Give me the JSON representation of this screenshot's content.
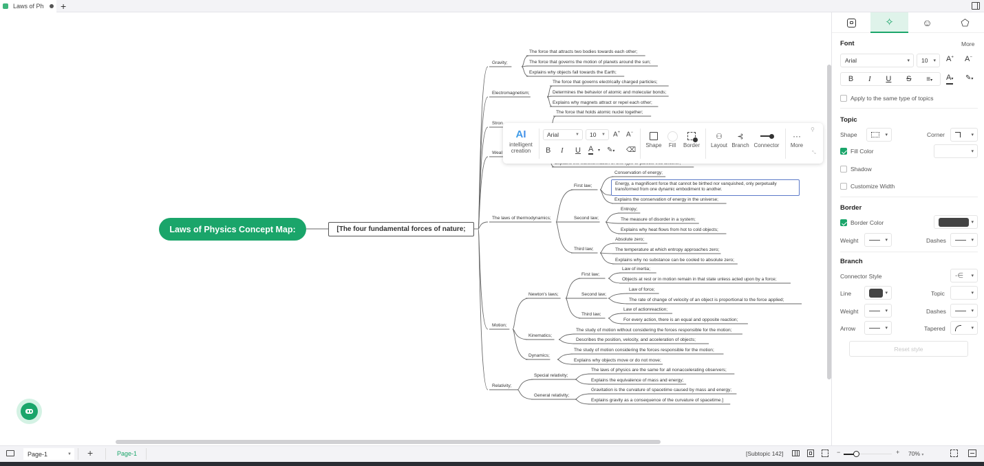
{
  "tabbar": {
    "doc_tab": "Laws of Ph",
    "new_tab": "+"
  },
  "mindmap": {
    "root": "Laws of Physics Concept Map:",
    "main": "[The four fundamental forces of nature;",
    "branches": [
      {
        "label": "Gravity;",
        "children": [
          "The force that attracts two bodies towards each other;",
          "The force that governs the motion of planets around the sun;",
          "Explains why objects fall towards the Earth;"
        ]
      },
      {
        "label": "Electromagnetism;",
        "children": [
          "The force that governs electrically charged particles;",
          "Determines the behavior of atomic and molecular bonds;",
          "Explains why magnets attract or repel each other;"
        ]
      },
      {
        "label": "Stron",
        "children": [
          "The force that holds atomic nuclei together;"
        ]
      },
      {
        "label": "Weal",
        "children": [
          "Explains the transformation of one type of particle into another;"
        ]
      },
      {
        "label": "The laws of thermodynamics;",
        "children": [
          {
            "label": "First law;",
            "children": [
              "Conservation of energy;",
              "Energy, a magnificent force that cannot be birthed nor vanquished, only perpetually transformed from one dynamic embodiment to another.",
              "Explains the conservation of energy in the universe;"
            ]
          },
          {
            "label": "Second law;",
            "children": [
              "Entropy;",
              "The measure of disorder in a system;",
              "Explains why heat flows from hot to cold objects;"
            ]
          },
          {
            "label": "Third law;",
            "children": [
              "Absolute zero;",
              "The temperature at which entropy approaches zero;",
              "Explains why no substance can be cooled to absolute zero;"
            ]
          }
        ]
      },
      {
        "label": "Motion;",
        "children": [
          {
            "label": "Newton's laws;",
            "children": [
              {
                "label": "First law;",
                "children": [
                  "Law of inertia;",
                  "Objects at rest or in motion remain in that state unless acted upon by a force;"
                ]
              },
              {
                "label": "Second law;",
                "children": [
                  "Law of force;",
                  "The rate of change of velocity of an object is proportional to the force applied;"
                ]
              },
              {
                "label": "Third law;",
                "children": [
                  "Law of actionreaction;",
                  "For every action, there is an equal and opposite reaction;"
                ]
              }
            ]
          },
          {
            "label": "Kinematics;",
            "children": [
              "The study of motion without considering the forces responsible for the motion;",
              "Describes the position, velocity, and acceleration of objects;"
            ]
          },
          {
            "label": "Dynamics;",
            "children": [
              "The study of motion considering the forces responsible for the motion;",
              "Explains why objects move or do not move;"
            ]
          }
        ]
      },
      {
        "label": "Relativity;",
        "children": [
          {
            "label": "Special relativity;",
            "children": [
              "The laws of physics are the same for all nonaccelerating observers;",
              "Explains the equivalence of mass and energy;"
            ]
          },
          {
            "label": "General relativity;",
            "children": [
              "Gravitation is the curvature of spacetime caused by mass and energy;",
              "Explains gravity as a consequence of the curvature of spacetime.]"
            ]
          }
        ]
      }
    ]
  },
  "floating_toolbar": {
    "ai_icon": "AI",
    "ai_label": "intelligent creation",
    "font": "Arial",
    "size": "10",
    "grow_font": "A+",
    "shrink_font": "A-",
    "bold": "B",
    "italic": "I",
    "underline": "U",
    "font_color": "A",
    "shape": "Shape",
    "fill": "Fill",
    "border": "Border",
    "layout": "Layout",
    "branch": "Branch",
    "connector": "Connector",
    "more": "More"
  },
  "panel": {
    "tabs": [
      "page-style",
      "ai-style",
      "mark",
      "theme"
    ],
    "active_tab": 1,
    "font": {
      "title": "Font",
      "more": "More",
      "family": "Arial",
      "size": "10",
      "bold": "B",
      "italic": "I",
      "underline": "U",
      "strike": "S",
      "apply_same": "Apply to the same type of topics"
    },
    "topic": {
      "title": "Topic",
      "shape_label": "Shape",
      "corner_label": "Corner",
      "fill_color_label": "Fill Color",
      "fill_color_checked": true,
      "shadow_label": "Shadow",
      "shadow_checked": false,
      "custom_width_label": "Customize Width",
      "custom_width_checked": false
    },
    "border": {
      "title": "Border",
      "border_color_label": "Border Color",
      "border_color_checked": true,
      "border_color": "#444444",
      "weight_label": "Weight",
      "dashes_label": "Dashes"
    },
    "branch": {
      "title": "Branch",
      "connector_style_label": "Connector Style",
      "line_label": "Line",
      "line_color": "#444444",
      "topic_label": "Topic",
      "weight_label": "Weight",
      "dashes_label": "Dashes",
      "arrow_label": "Arrow",
      "tapered_label": "Tapered",
      "reset_label": "Reset style"
    }
  },
  "bottombar": {
    "page_select": "Page-1",
    "add_page": "+",
    "page_tab": "Page-1",
    "selection_info": "[Subtopic 142]",
    "zoom_minus": "−",
    "zoom_plus": "+",
    "zoom_level": "70%",
    "zoom_fraction": 0.25
  },
  "colors": {
    "accent": "#1aa56a",
    "selection": "#5a78c8"
  }
}
